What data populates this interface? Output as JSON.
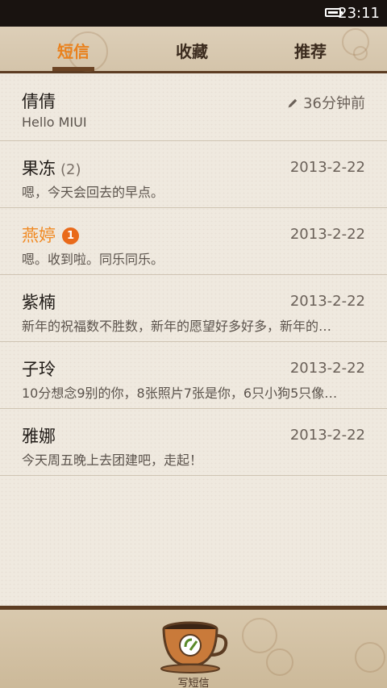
{
  "status_bar": {
    "time": "23:11",
    "battery_icon": "battery-full-icon"
  },
  "tabs": [
    {
      "label": "短信",
      "active": true
    },
    {
      "label": "收藏",
      "active": false
    },
    {
      "label": "推荐",
      "active": false
    }
  ],
  "messages": [
    {
      "name": "倩倩",
      "count": "",
      "badge": "",
      "date": "36分钟前",
      "draft_icon": "pencil-icon",
      "preview": "Hello MIUI",
      "unread": false
    },
    {
      "name": "果冻",
      "count": "(2)",
      "badge": "",
      "date": "2013-2-22",
      "preview": "嗯，今天会回去的早点。",
      "unread": false
    },
    {
      "name": "燕婷",
      "count": "",
      "badge": "1",
      "date": "2013-2-22",
      "preview": "嗯。收到啦。同乐同乐。",
      "unread": true
    },
    {
      "name": "紫楠",
      "count": "",
      "badge": "",
      "date": "2013-2-22",
      "preview": "新年的祝福数不胜数，新年的愿望好多好多，新年的…",
      "unread": false
    },
    {
      "name": "子玲",
      "count": "",
      "badge": "",
      "date": "2013-2-22",
      "preview": "10分想念9别的你，8张照片7张是你，6只小狗5只像…",
      "unread": false
    },
    {
      "name": "雅娜",
      "count": "",
      "badge": "",
      "date": "2013-2-22",
      "preview": "今天周五晚上去团建吧，走起！",
      "unread": false
    }
  ],
  "compose": {
    "label": "写短信",
    "icon": "coffee-cup-icon"
  },
  "colors": {
    "accent": "#f08a24",
    "badge": "#e96a1a",
    "brown": "#5c3c22"
  }
}
